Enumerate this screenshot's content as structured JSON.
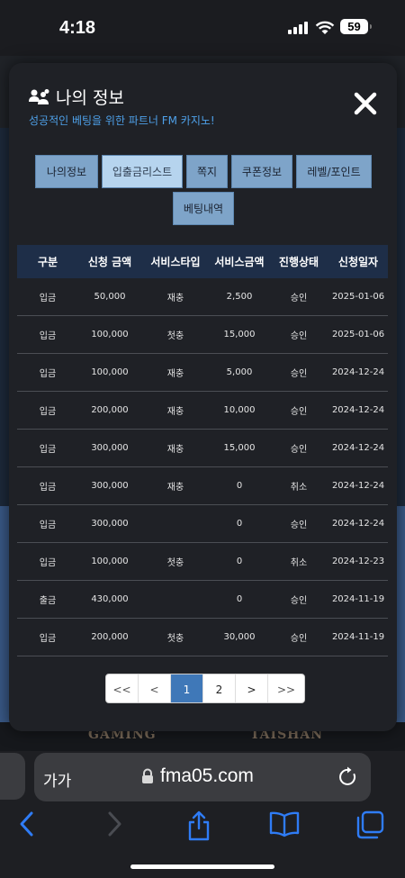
{
  "status_bar": {
    "time": "4:18",
    "battery": "59"
  },
  "background": {
    "logos": [
      "GAMING",
      "TAISHAN"
    ]
  },
  "modal": {
    "title": "나의 정보",
    "subtitle": "성공적인 베팅을 위한 파트너 FM 카지노!",
    "tabs": [
      "나의정보",
      "입출금리스트",
      "쪽지",
      "쿠폰정보",
      "레벨/포인트",
      "베팅내역"
    ],
    "active_tab": "입출금리스트",
    "table": {
      "headers": [
        "구분",
        "신청 금액",
        "서비스타입",
        "서비스금액",
        "진행상태",
        "신청일자"
      ],
      "rows": [
        [
          "입금",
          "50,000",
          "재충",
          "2,500",
          "승인",
          "2025-01-06"
        ],
        [
          "입금",
          "100,000",
          "첫충",
          "15,000",
          "승인",
          "2025-01-06"
        ],
        [
          "입금",
          "100,000",
          "재충",
          "5,000",
          "승인",
          "2024-12-24"
        ],
        [
          "입금",
          "200,000",
          "재충",
          "10,000",
          "승인",
          "2024-12-24"
        ],
        [
          "입금",
          "300,000",
          "재충",
          "15,000",
          "승인",
          "2024-12-24"
        ],
        [
          "입금",
          "300,000",
          "재충",
          "0",
          "취소",
          "2024-12-24"
        ],
        [
          "입금",
          "300,000",
          "",
          "0",
          "승인",
          "2024-12-24"
        ],
        [
          "입금",
          "100,000",
          "첫충",
          "0",
          "취소",
          "2024-12-23"
        ],
        [
          "출금",
          "430,000",
          "",
          "0",
          "승인",
          "2024-11-19"
        ],
        [
          "입금",
          "200,000",
          "첫충",
          "30,000",
          "승인",
          "2024-11-19"
        ]
      ]
    },
    "pagination": [
      "<<",
      "<",
      "1",
      "2",
      ">",
      ">>"
    ],
    "current_page": "1"
  },
  "browser": {
    "text_size_label": "가가",
    "url": "fma05.com"
  },
  "colors": {
    "accent": "#4ea0e8",
    "table_header": "#1e2e48",
    "tab": "#7ea4c9",
    "tab_active": "#b6d4ee",
    "page_active": "#3f78b8",
    "ios_blue": "#2f7cf6"
  }
}
